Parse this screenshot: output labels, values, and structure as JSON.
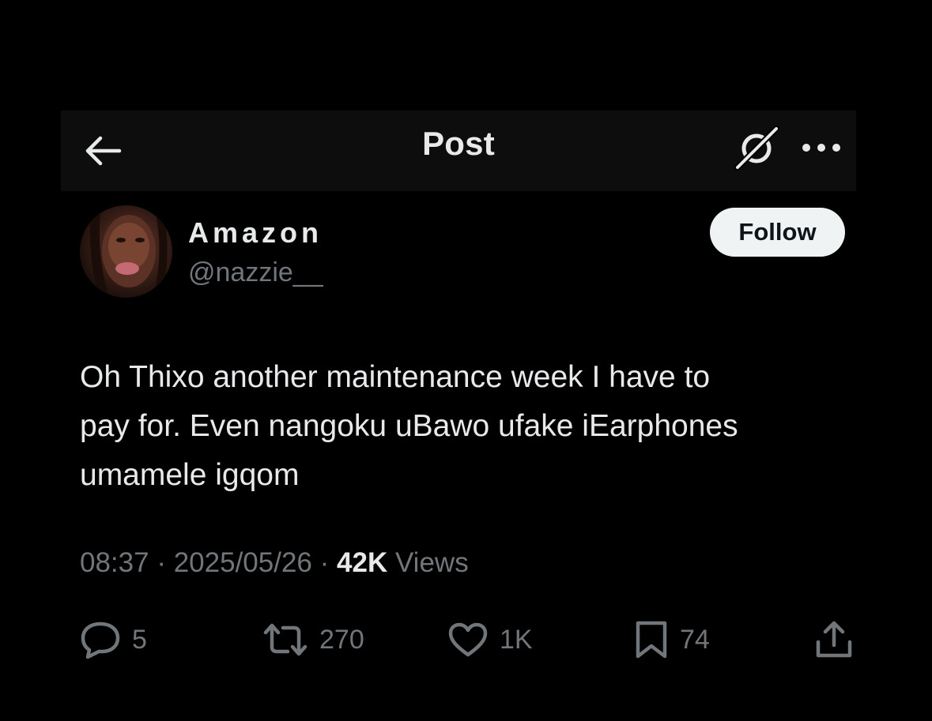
{
  "header": {
    "title": "Post",
    "back_icon": "arrow-left-icon",
    "grok_icon": "grok-icon",
    "more_icon": "more-horizontal-icon"
  },
  "author": {
    "display_name": "Amazon",
    "handle": "@nazzie__",
    "follow_label": "Follow"
  },
  "post": {
    "text": "Oh Thixo another maintenance week I have to\npay for. Even nangoku uBawo ufake iEarphones\numamele igqom"
  },
  "meta": {
    "time": "08:37",
    "separator": "·",
    "date": "2025/05/26",
    "views_count": "42K",
    "views_label": "Views"
  },
  "actions": {
    "replies": "5",
    "reposts": "270",
    "likes": "1K",
    "bookmarks": "74",
    "share_icon": "share-icon"
  },
  "colors": {
    "background": "#000000",
    "header_bg": "#0d0d0d",
    "text_primary": "#e7e9ea",
    "text_secondary": "#71767b",
    "follow_bg": "#eff3f4"
  }
}
